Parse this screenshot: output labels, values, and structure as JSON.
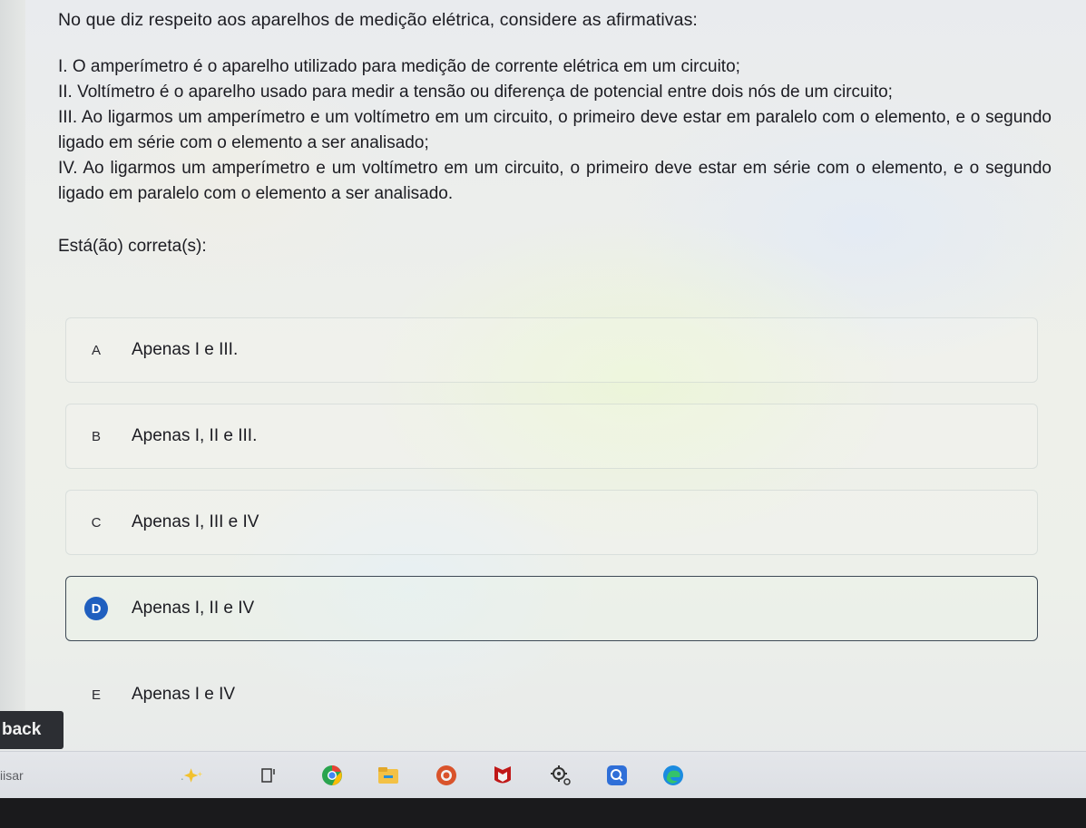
{
  "question": {
    "prompt": "No que diz respeito aos aparelhos de medição elétrica, considere as afirmativas:",
    "statements": [
      "I. O amperímetro é o aparelho utilizado para medição de corrente elétrica em um circuito;",
      "II. Voltímetro é o aparelho usado para medir a tensão ou diferença de potencial entre dois nós de um circuito;",
      "III. Ao ligarmos um amperímetro e um voltímetro em um circuito, o primeiro deve estar em paralelo com o elemento, e o segundo ligado em série com o elemento a ser analisado;",
      "IV. Ao ligarmos um amperímetro e um voltímetro em um circuito, o primeiro deve estar em série com o elemento, e o segundo ligado em paralelo com o elemento a ser analisado."
    ],
    "correct_label": "Está(ão) correta(s):"
  },
  "options": [
    {
      "letter": "A",
      "text": "Apenas I e III."
    },
    {
      "letter": "B",
      "text": "Apenas I, II e III."
    },
    {
      "letter": "C",
      "text": "Apenas I, III e IV"
    },
    {
      "letter": "D",
      "text": "Apenas I, II e IV"
    },
    {
      "letter": "E",
      "text": "Apenas I e IV"
    }
  ],
  "selected_option": "D",
  "back_button": {
    "label": "back"
  },
  "taskbar": {
    "search_text": "iisar",
    "icons": [
      "copilot-icon",
      "task-view-icon",
      "chrome-icon",
      "file-explorer-icon",
      "office-icon",
      "mcafee-icon",
      "settings-icon",
      "search-app-icon",
      "edge-icon"
    ]
  },
  "colors": {
    "selected_accent": "#1f5fbf",
    "back_button_bg": "#2c2e33",
    "bezel": "#1a1a1c"
  }
}
